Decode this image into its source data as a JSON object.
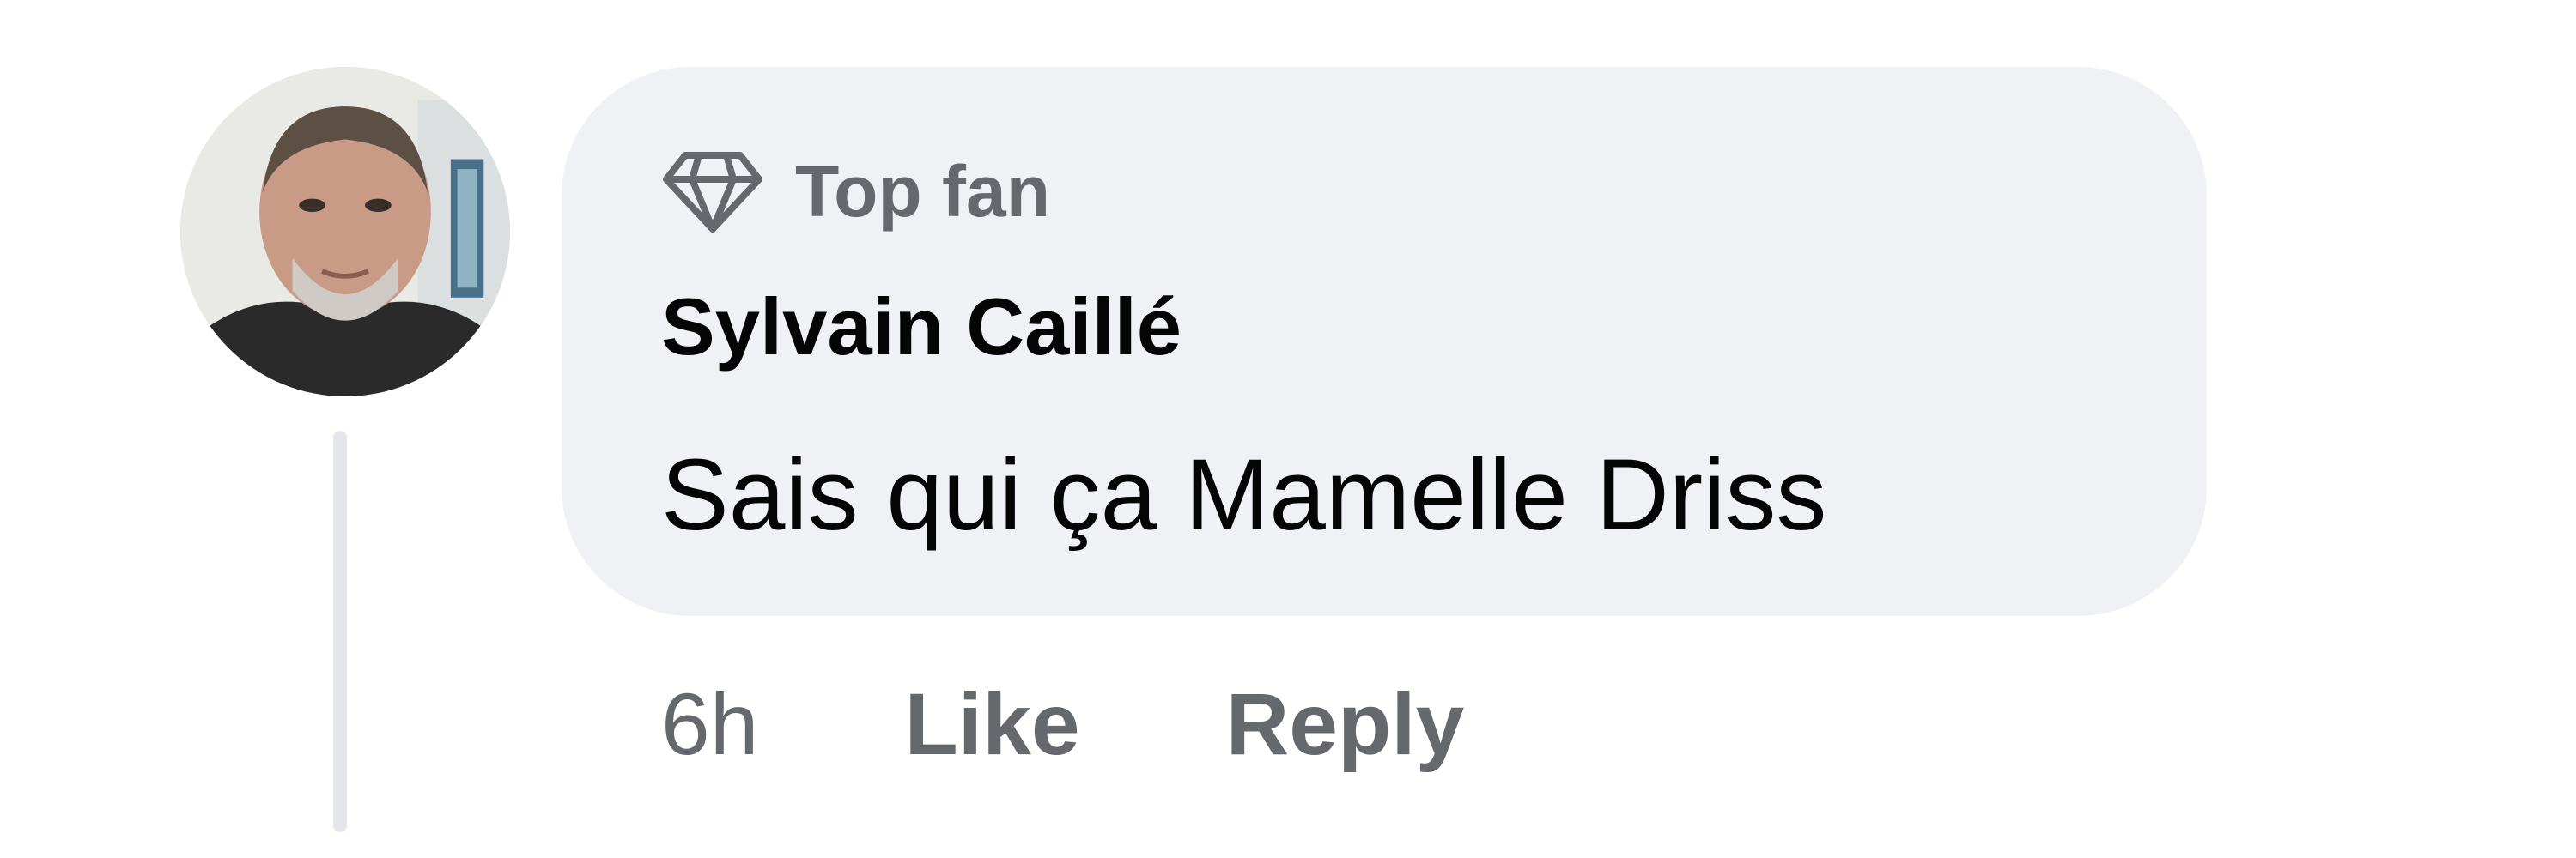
{
  "comment": {
    "badge": {
      "icon": "diamond-icon",
      "label": "Top fan"
    },
    "author": "Sylvain Caillé",
    "text": "Sais qui ça Mamelle Driss",
    "timestamp": "6h",
    "actions": {
      "like_label": "Like",
      "reply_label": "Reply"
    },
    "avatar_icon": "avatar"
  },
  "colors": {
    "bubble_bg": "#f0f1f5",
    "secondary_text": "#65686c",
    "primary_text": "#050505",
    "thread_line": "#e4e6eb"
  }
}
